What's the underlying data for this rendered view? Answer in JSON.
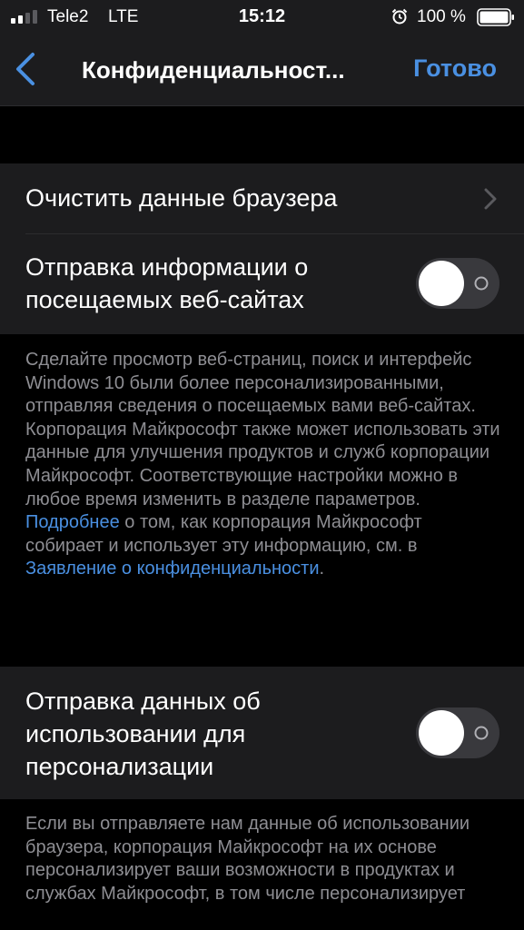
{
  "status_bar": {
    "carrier": "Tele2",
    "network": "LTE",
    "time": "15:12",
    "battery": "100 %",
    "icons": [
      "signal-icon",
      "alarm-icon",
      "battery-icon"
    ]
  },
  "nav": {
    "title": "Конфиденциальност...",
    "done_label": "Готово",
    "back_icon": "chevron-left-icon"
  },
  "settings": {
    "clear_data_label": "Очистить данные браузера",
    "send_sites_label": "Отправка информации о посещаемых веб-сайтах",
    "send_sites_enabled": false,
    "send_sites_description_before": "Сделайте просмотр веб-страниц, поиск и интерфейс Windows 10 были более персонализированными, отправляя сведения о посещаемых вами веб-сайтах. Корпорация Майкрософт также может использовать эти данные для улучшения продуктов и служб корпорации Майкрософт. Соответствующие настройки можно в любое время изменить в разделе параметров. ",
    "learn_more_link": "Подробнее",
    "send_sites_description_middle": " о том, как корпорация Майкрософт собирает и использует эту информацию, см. в ",
    "privacy_statement_link": "Заявление о конфиденциальности",
    "send_sites_description_after": ".",
    "usage_label": "Отправка данных об использовании для персонализации",
    "usage_enabled": false,
    "usage_description": "Если вы отправляете нам данные об использовании браузера, корпорация Майкрософт на их основе персонализирует ваши возможности в продуктах и службах Майкрософт, в том числе персонализирует"
  },
  "colors": {
    "background": "#000000",
    "cell": "#1c1c1e",
    "accent": "#4a90e2",
    "secondary_text": "#8e8e93"
  }
}
